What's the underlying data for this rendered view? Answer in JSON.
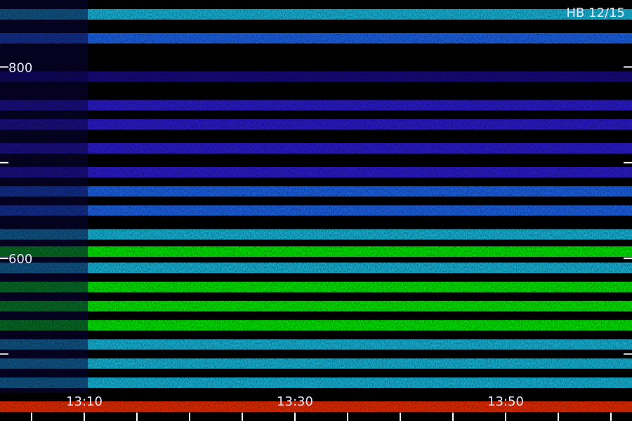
{
  "chart_data": {
    "type": "heatmap",
    "title": "HB 12/15",
    "xlabel": "",
    "ylabel": "",
    "y_ticks": [
      {
        "value": 800,
        "label": "800"
      },
      {
        "value": 700,
        "label": ""
      },
      {
        "value": 600,
        "label": "600"
      },
      {
        "value": 500,
        "label": ""
      }
    ],
    "x_ticks": [
      {
        "value": "13:10",
        "label": "13:10"
      },
      {
        "value": "13:30",
        "label": "13:30"
      },
      {
        "value": "13:50",
        "label": "13:50"
      }
    ],
    "x_range": [
      "13:02",
      "14:02"
    ],
    "y_range": [
      430,
      870
    ],
    "colormap": [
      "#000000",
      "#1a0a8c",
      "#2f1fe0",
      "#1f6cff",
      "#19c8f0",
      "#00ff00",
      "#ffff00",
      "#ff3000"
    ],
    "bands": [
      {
        "freq": 855,
        "intensity": 0.62
      },
      {
        "freq": 830,
        "intensity": 0.45
      },
      {
        "freq": 790,
        "intensity": 0.18
      },
      {
        "freq": 760,
        "intensity": 0.32
      },
      {
        "freq": 740,
        "intensity": 0.26
      },
      {
        "freq": 715,
        "intensity": 0.22
      },
      {
        "freq": 690,
        "intensity": 0.35
      },
      {
        "freq": 670,
        "intensity": 0.4
      },
      {
        "freq": 650,
        "intensity": 0.45
      },
      {
        "freq": 625,
        "intensity": 0.55
      },
      {
        "freq": 607,
        "intensity": 0.68
      },
      {
        "freq": 590,
        "intensity": 0.62
      },
      {
        "freq": 570,
        "intensity": 0.66
      },
      {
        "freq": 550,
        "intensity": 0.7
      },
      {
        "freq": 530,
        "intensity": 0.66
      },
      {
        "freq": 510,
        "intensity": 0.62
      },
      {
        "freq": 490,
        "intensity": 0.58
      },
      {
        "freq": 470,
        "intensity": 0.55
      },
      {
        "freq": 445,
        "intensity": 0.95
      }
    ]
  }
}
